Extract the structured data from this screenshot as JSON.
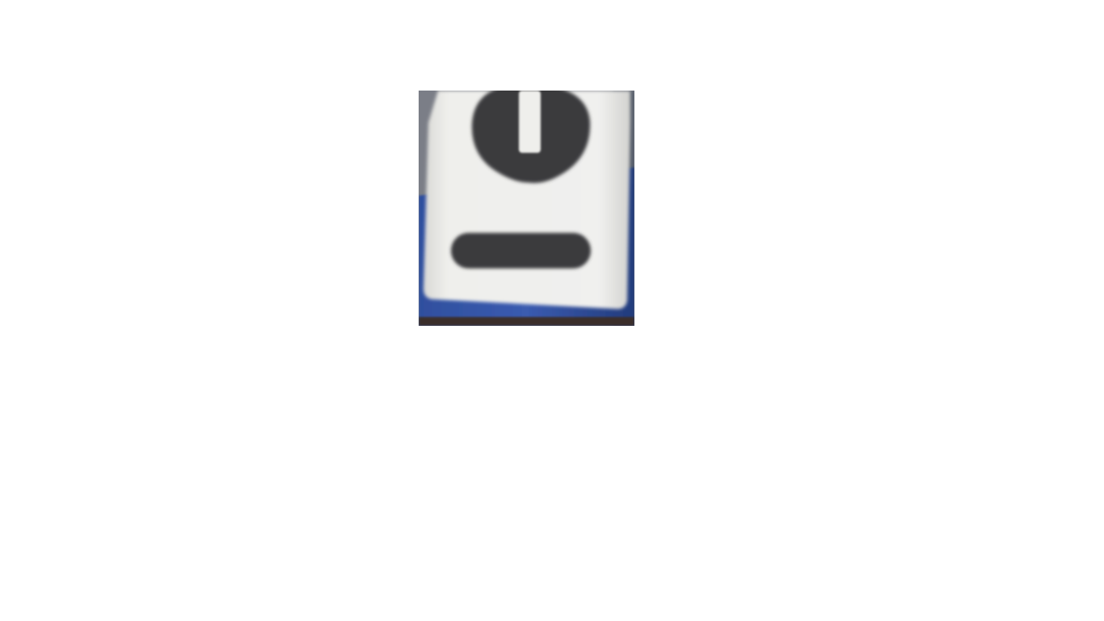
{
  "viewer": {
    "image": {
      "subject": "blurry-photo-of-white-card-with-dark-ellipse-and-bar",
      "colors": {
        "background": "#ffffff",
        "card": "#efefed",
        "card_shadow": "#d8d8d6",
        "dark_shape": "#3a3a3c",
        "blue_surface": "#3856a8",
        "blue_dark": "#243f86",
        "bottom_edge": "#3b2e2a",
        "left_gray": "#7a7d86"
      }
    }
  }
}
